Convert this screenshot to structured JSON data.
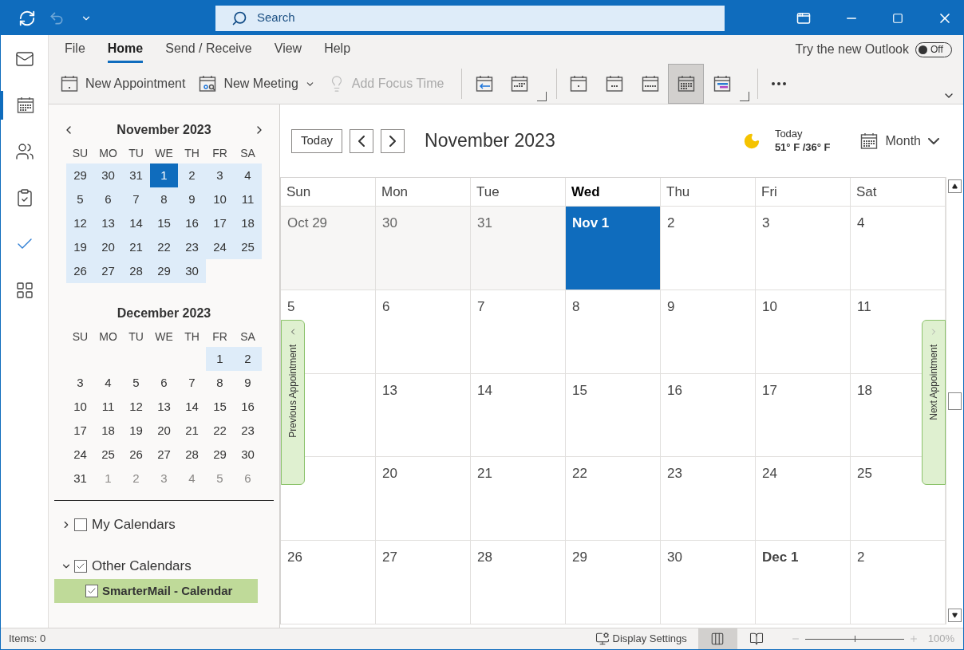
{
  "title_bar": {
    "search": {
      "placeholder": "Search"
    }
  },
  "ribbon": {
    "tabs": [
      {
        "label": "File",
        "selected": false
      },
      {
        "label": "Home",
        "selected": true
      },
      {
        "label": "Send / Receive",
        "selected": false
      },
      {
        "label": "View",
        "selected": false
      },
      {
        "label": "Help",
        "selected": false
      }
    ],
    "new_outlook": {
      "label": "Try the new Outlook",
      "toggle": "Off",
      "on": false
    },
    "commands": [
      {
        "kind": "appointment",
        "label": "New Appointment",
        "disabled": false,
        "dropdown": false
      },
      {
        "kind": "meeting",
        "label": "New Meeting",
        "disabled": false,
        "dropdown": true
      },
      {
        "kind": "focus",
        "label": "Add Focus Time",
        "disabled": true,
        "dropdown": false
      }
    ],
    "go_to": [
      {
        "kind": "today",
        "selected": false
      },
      {
        "kind": "next7",
        "selected": false
      }
    ],
    "arrange": [
      {
        "kind": "day",
        "selected": false
      },
      {
        "kind": "workweek",
        "selected": false
      },
      {
        "kind": "week",
        "selected": false
      },
      {
        "kind": "month",
        "selected": true
      },
      {
        "kind": "schedule",
        "selected": false
      }
    ]
  },
  "nav_rail": [
    {
      "kind": "mail",
      "selected": false
    },
    {
      "kind": "calendar",
      "selected": true
    },
    {
      "kind": "people",
      "selected": false
    },
    {
      "kind": "tasks",
      "selected": false
    },
    {
      "kind": "todo",
      "selected": false
    },
    {
      "kind": "apps",
      "selected": false
    }
  ],
  "mini_calendars": [
    {
      "title": "November 2023",
      "weekdays": [
        "SU",
        "MO",
        "TU",
        "WE",
        "TH",
        "FR",
        "SA"
      ],
      "weeks": [
        {
          "highlight": true,
          "days": [
            {
              "label": "29",
              "selected": false,
              "dim": false
            },
            {
              "label": "30",
              "selected": false,
              "dim": false
            },
            {
              "label": "31",
              "selected": false,
              "dim": false
            },
            {
              "label": "1",
              "selected": true,
              "dim": false
            },
            {
              "label": "2",
              "selected": false,
              "dim": false
            },
            {
              "label": "3",
              "selected": false,
              "dim": false
            },
            {
              "label": "4",
              "selected": false,
              "dim": false
            }
          ]
        },
        {
          "highlight": true,
          "days": [
            {
              "label": "5",
              "selected": false,
              "dim": false
            },
            {
              "label": "6",
              "selected": false,
              "dim": false
            },
            {
              "label": "7",
              "selected": false,
              "dim": false
            },
            {
              "label": "8",
              "selected": false,
              "dim": false
            },
            {
              "label": "9",
              "selected": false,
              "dim": false
            },
            {
              "label": "10",
              "selected": false,
              "dim": false
            },
            {
              "label": "11",
              "selected": false,
              "dim": false
            }
          ]
        },
        {
          "highlight": true,
          "days": [
            {
              "label": "12",
              "selected": false,
              "dim": false
            },
            {
              "label": "13",
              "selected": false,
              "dim": false
            },
            {
              "label": "14",
              "selected": false,
              "dim": false
            },
            {
              "label": "15",
              "selected": false,
              "dim": false
            },
            {
              "label": "16",
              "selected": false,
              "dim": false
            },
            {
              "label": "17",
              "selected": false,
              "dim": false
            },
            {
              "label": "18",
              "selected": false,
              "dim": false
            }
          ]
        },
        {
          "highlight": true,
          "days": [
            {
              "label": "19",
              "selected": false,
              "dim": false
            },
            {
              "label": "20",
              "selected": false,
              "dim": false
            },
            {
              "label": "21",
              "selected": false,
              "dim": false
            },
            {
              "label": "22",
              "selected": false,
              "dim": false
            },
            {
              "label": "23",
              "selected": false,
              "dim": false
            },
            {
              "label": "24",
              "selected": false,
              "dim": false
            },
            {
              "label": "25",
              "selected": false,
              "dim": false
            }
          ]
        },
        {
          "highlight": true,
          "days": [
            {
              "label": "26",
              "selected": false,
              "dim": false
            },
            {
              "label": "27",
              "selected": false,
              "dim": false
            },
            {
              "label": "28",
              "selected": false,
              "dim": false
            },
            {
              "label": "29",
              "selected": false,
              "dim": false
            },
            {
              "label": "30",
              "selected": false,
              "dim": false
            }
          ]
        }
      ]
    },
    {
      "title": "December 2023",
      "weekdays": [
        "SU",
        "MO",
        "TU",
        "WE",
        "TH",
        "FR",
        "SA"
      ],
      "weeks": [
        {
          "highlight": true,
          "days": [
            {
              "label": "1",
              "selected": false,
              "dim": false
            },
            {
              "label": "2",
              "selected": false,
              "dim": false
            }
          ]
        },
        {
          "highlight": false,
          "days": [
            {
              "label": "3",
              "selected": false,
              "dim": false
            },
            {
              "label": "4",
              "selected": false,
              "dim": false
            },
            {
              "label": "5",
              "selected": false,
              "dim": false
            },
            {
              "label": "6",
              "selected": false,
              "dim": false
            },
            {
              "label": "7",
              "selected": false,
              "dim": false
            },
            {
              "label": "8",
              "selected": false,
              "dim": false
            },
            {
              "label": "9",
              "selected": false,
              "dim": false
            }
          ]
        },
        {
          "highlight": false,
          "days": [
            {
              "label": "10",
              "selected": false,
              "dim": false
            },
            {
              "label": "11",
              "selected": false,
              "dim": false
            },
            {
              "label": "12",
              "selected": false,
              "dim": false
            },
            {
              "label": "13",
              "selected": false,
              "dim": false
            },
            {
              "label": "14",
              "selected": false,
              "dim": false
            },
            {
              "label": "15",
              "selected": false,
              "dim": false
            },
            {
              "label": "16",
              "selected": false,
              "dim": false
            }
          ]
        },
        {
          "highlight": false,
          "days": [
            {
              "label": "17",
              "selected": false,
              "dim": false
            },
            {
              "label": "18",
              "selected": false,
              "dim": false
            },
            {
              "label": "19",
              "selected": false,
              "dim": false
            },
            {
              "label": "20",
              "selected": false,
              "dim": false
            },
            {
              "label": "21",
              "selected": false,
              "dim": false
            },
            {
              "label": "22",
              "selected": false,
              "dim": false
            },
            {
              "label": "23",
              "selected": false,
              "dim": false
            }
          ]
        },
        {
          "highlight": false,
          "days": [
            {
              "label": "24",
              "selected": false,
              "dim": false
            },
            {
              "label": "25",
              "selected": false,
              "dim": false
            },
            {
              "label": "26",
              "selected": false,
              "dim": false
            },
            {
              "label": "27",
              "selected": false,
              "dim": false
            },
            {
              "label": "28",
              "selected": false,
              "dim": false
            },
            {
              "label": "29",
              "selected": false,
              "dim": false
            },
            {
              "label": "30",
              "selected": false,
              "dim": false
            }
          ]
        },
        {
          "highlight": false,
          "days": [
            {
              "label": "31",
              "selected": false,
              "dim": false
            },
            {
              "label": "1",
              "selected": false,
              "dim": true
            },
            {
              "label": "2",
              "selected": false,
              "dim": true
            },
            {
              "label": "3",
              "selected": false,
              "dim": true
            },
            {
              "label": "4",
              "selected": false,
              "dim": true
            },
            {
              "label": "5",
              "selected": false,
              "dim": true
            },
            {
              "label": "6",
              "selected": false,
              "dim": true
            }
          ]
        }
      ]
    }
  ],
  "calendar_groups": [
    {
      "label": "My Calendars",
      "expanded": false,
      "checked": false
    },
    {
      "label": "Other Calendars",
      "expanded": true,
      "checked": true,
      "children": [
        {
          "label": "SmarterMail - Calendar",
          "checked": true,
          "selected": true
        }
      ]
    }
  ],
  "toolbar": {
    "today_button": "Today",
    "title": "November 2023",
    "weather": {
      "label": "Today",
      "temps": "51° F /36° F"
    },
    "view": "Month"
  },
  "month_grid": {
    "weekdays": [
      {
        "label": "Sun",
        "current": false
      },
      {
        "label": "Mon",
        "current": false
      },
      {
        "label": "Tue",
        "current": false
      },
      {
        "label": "Wed",
        "current": true
      },
      {
        "label": "Thu",
        "current": false
      },
      {
        "label": "Fri",
        "current": false
      },
      {
        "label": "Sat",
        "current": false
      }
    ],
    "weeks": [
      [
        {
          "label": "Oct 29",
          "bold": false,
          "shaded": true,
          "selected": false
        },
        {
          "label": "30",
          "bold": false,
          "shaded": true,
          "selected": false
        },
        {
          "label": "31",
          "bold": false,
          "shaded": true,
          "selected": false
        },
        {
          "label": "Nov 1",
          "bold": true,
          "shaded": false,
          "selected": true
        },
        {
          "label": "2",
          "bold": false,
          "shaded": false,
          "selected": false
        },
        {
          "label": "3",
          "bold": false,
          "shaded": false,
          "selected": false
        },
        {
          "label": "4",
          "bold": false,
          "shaded": false,
          "selected": false
        }
      ],
      [
        {
          "label": "5",
          "bold": false,
          "shaded": false,
          "selected": false
        },
        {
          "label": "6",
          "bold": false,
          "shaded": false,
          "selected": false
        },
        {
          "label": "7",
          "bold": false,
          "shaded": false,
          "selected": false
        },
        {
          "label": "8",
          "bold": false,
          "shaded": false,
          "selected": false
        },
        {
          "label": "9",
          "bold": false,
          "shaded": false,
          "selected": false
        },
        {
          "label": "10",
          "bold": false,
          "shaded": false,
          "selected": false
        },
        {
          "label": "11",
          "bold": false,
          "shaded": false,
          "selected": false
        }
      ],
      [
        {
          "selected": false
        },
        {
          "label": "13",
          "bold": false,
          "shaded": false,
          "selected": false
        },
        {
          "label": "14",
          "bold": false,
          "shaded": false,
          "selected": false
        },
        {
          "label": "15",
          "bold": false,
          "shaded": false,
          "selected": false
        },
        {
          "label": "16",
          "bold": false,
          "shaded": false,
          "selected": false
        },
        {
          "label": "17",
          "bold": false,
          "shaded": false,
          "selected": false
        },
        {
          "label": "18",
          "bold": false,
          "shaded": false,
          "selected": false
        }
      ],
      [
        {
          "selected": false
        },
        {
          "label": "20",
          "bold": false,
          "shaded": false,
          "selected": false
        },
        {
          "label": "21",
          "bold": false,
          "shaded": false,
          "selected": false
        },
        {
          "label": "22",
          "bold": false,
          "shaded": false,
          "selected": false
        },
        {
          "label": "23",
          "bold": false,
          "shaded": false,
          "selected": false
        },
        {
          "label": "24",
          "bold": false,
          "shaded": false,
          "selected": false
        },
        {
          "label": "25",
          "bold": false,
          "shaded": false,
          "selected": false
        }
      ],
      [
        {
          "label": "26",
          "bold": false,
          "shaded": false,
          "selected": false
        },
        {
          "label": "27",
          "bold": false,
          "shaded": false,
          "selected": false
        },
        {
          "label": "28",
          "bold": false,
          "shaded": false,
          "selected": false
        },
        {
          "label": "29",
          "bold": false,
          "shaded": false,
          "selected": false
        },
        {
          "label": "30",
          "bold": false,
          "shaded": false,
          "selected": false
        },
        {
          "label": "Dec 1",
          "bold": true,
          "shaded": false,
          "selected": false
        },
        {
          "label": "2",
          "bold": false,
          "shaded": false,
          "selected": false
        }
      ]
    ],
    "previous_tab": "Previous Appointment",
    "next_tab": "Next Appointment"
  },
  "status_bar": {
    "items": "Items: 0",
    "display_settings": "Display Settings",
    "views": [
      {
        "kind": "normal",
        "selected": true
      },
      {
        "kind": "reading",
        "selected": false
      }
    ],
    "zoom": {
      "level": 0.5,
      "reading": "100%"
    }
  }
}
